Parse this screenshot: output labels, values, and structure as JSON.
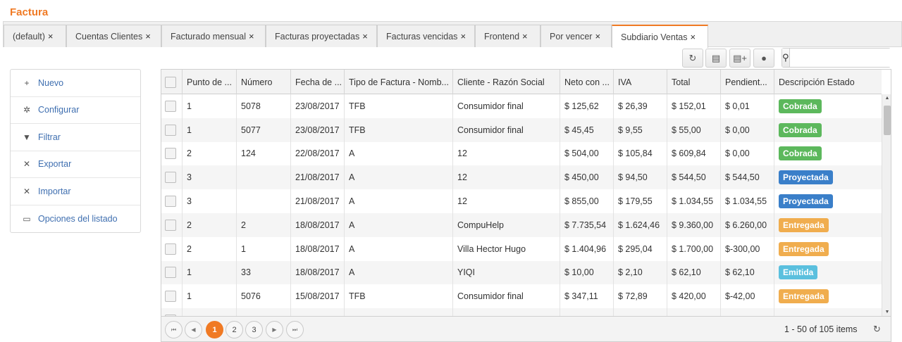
{
  "page": {
    "title": "Factura"
  },
  "tabs": [
    {
      "label": "(default)",
      "close": "×"
    },
    {
      "label": "Cuentas Clientes",
      "close": "×"
    },
    {
      "label": "Facturado mensual",
      "close": "×"
    },
    {
      "label": "Facturas proyectadas",
      "close": "×"
    },
    {
      "label": "Facturas vencidas",
      "close": "×"
    },
    {
      "label": "Frontend",
      "close": "×"
    },
    {
      "label": "Por vencer",
      "close": "×"
    },
    {
      "label": "Subdiario Ventas",
      "close": "×",
      "active": true
    }
  ],
  "toolbar": {
    "refresh_icon": "↻",
    "save_icon": "▤",
    "save_as_icon": "▤+",
    "comment_icon": "●",
    "search_icon": "⚲",
    "search_value": ""
  },
  "sidemenu": {
    "items": [
      {
        "label": "Nuevo",
        "icon": "+"
      },
      {
        "label": "Configurar",
        "icon": "✲"
      },
      {
        "label": "Filtrar",
        "icon": "▼"
      },
      {
        "label": "Exportar",
        "icon": "✕"
      },
      {
        "label": "Importar",
        "icon": "✕"
      },
      {
        "label": "Opciones del listado",
        "icon": "▭"
      }
    ]
  },
  "grid": {
    "columns": [
      "Punto de ...",
      "Número",
      "Fecha de ...",
      "Tipo de Factura - Nomb...",
      "Cliente - Razón Social",
      "Neto con ...",
      "IVA",
      "Total",
      "Pendient...",
      "Descripción Estado"
    ],
    "rows": [
      {
        "punto": "1",
        "numero": "5078",
        "fecha": "23/08/2017",
        "tipo": "TFB",
        "cliente": "Consumidor final",
        "neto": "$ 125,62",
        "iva": "$ 26,39",
        "total": "$ 152,01",
        "pendiente": "$ 0,01",
        "estado": "Cobrada",
        "color": "#5cb85c"
      },
      {
        "punto": "1",
        "numero": "5077",
        "fecha": "23/08/2017",
        "tipo": "TFB",
        "cliente": "Consumidor final",
        "neto": "$ 45,45",
        "iva": "$ 9,55",
        "total": "$ 55,00",
        "pendiente": "$ 0,00",
        "estado": "Cobrada",
        "color": "#5cb85c"
      },
      {
        "punto": "2",
        "numero": "124",
        "fecha": "22/08/2017",
        "tipo": "A",
        "cliente": "12",
        "neto": "$ 504,00",
        "iva": "$ 105,84",
        "total": "$ 609,84",
        "pendiente": "$ 0,00",
        "estado": "Cobrada",
        "color": "#5cb85c"
      },
      {
        "punto": "3",
        "numero": "",
        "fecha": "21/08/2017",
        "tipo": "A",
        "cliente": "12",
        "neto": "$ 450,00",
        "iva": "$ 94,50",
        "total": "$ 544,50",
        "pendiente": "$ 544,50",
        "estado": "Proyectada",
        "color": "#3a7fc9"
      },
      {
        "punto": "3",
        "numero": "",
        "fecha": "21/08/2017",
        "tipo": "A",
        "cliente": "12",
        "neto": "$ 855,00",
        "iva": "$ 179,55",
        "total": "$ 1.034,55",
        "pendiente": "$ 1.034,55",
        "estado": "Proyectada",
        "color": "#3a7fc9"
      },
      {
        "punto": "2",
        "numero": "2",
        "fecha": "18/08/2017",
        "tipo": "A",
        "cliente": "CompuHelp",
        "neto": "$ 7.735,54",
        "iva": "$ 1.624,46",
        "total": "$ 9.360,00",
        "pendiente": "$ 6.260,00",
        "estado": "Entregada",
        "color": "#f0ad4e"
      },
      {
        "punto": "2",
        "numero": "1",
        "fecha": "18/08/2017",
        "tipo": "A",
        "cliente": "Villa Hector Hugo",
        "neto": "$ 1.404,96",
        "iva": "$ 295,04",
        "total": "$ 1.700,00",
        "pendiente": "$-300,00",
        "estado": "Entregada",
        "color": "#f0ad4e"
      },
      {
        "punto": "1",
        "numero": "33",
        "fecha": "18/08/2017",
        "tipo": "A",
        "cliente": "YIQI",
        "neto": "$ 10,00",
        "iva": "$ 2,10",
        "total": "$ 62,10",
        "pendiente": "$ 62,10",
        "estado": "Emitida",
        "color": "#5bc0de"
      },
      {
        "punto": "1",
        "numero": "5076",
        "fecha": "15/08/2017",
        "tipo": "TFB",
        "cliente": "Consumidor final",
        "neto": "$ 347,11",
        "iva": "$ 72,89",
        "total": "$ 420,00",
        "pendiente": "$-42,00",
        "estado": "Entregada",
        "color": "#f0ad4e"
      }
    ]
  },
  "pager": {
    "first_icon": "⏮",
    "prev_icon": "◀",
    "next_icon": "▶",
    "last_icon": "⏭",
    "pages": [
      "1",
      "2",
      "3"
    ],
    "current": "1",
    "info": "1 - 50 of 105 items",
    "refresh_icon": "↻"
  }
}
